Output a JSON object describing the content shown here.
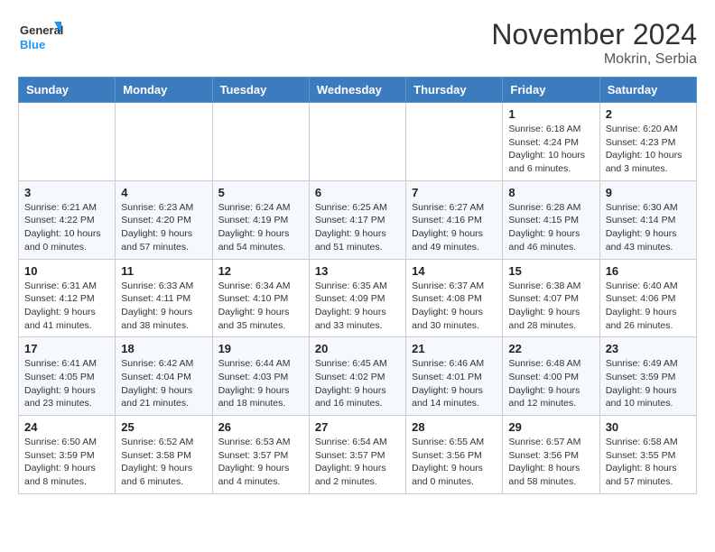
{
  "header": {
    "logo_line1": "General",
    "logo_line2": "Blue",
    "month": "November 2024",
    "location": "Mokrin, Serbia"
  },
  "weekdays": [
    "Sunday",
    "Monday",
    "Tuesday",
    "Wednesday",
    "Thursday",
    "Friday",
    "Saturday"
  ],
  "weeks": [
    [
      {
        "day": "",
        "info": ""
      },
      {
        "day": "",
        "info": ""
      },
      {
        "day": "",
        "info": ""
      },
      {
        "day": "",
        "info": ""
      },
      {
        "day": "",
        "info": ""
      },
      {
        "day": "1",
        "info": "Sunrise: 6:18 AM\nSunset: 4:24 PM\nDaylight: 10 hours\nand 6 minutes."
      },
      {
        "day": "2",
        "info": "Sunrise: 6:20 AM\nSunset: 4:23 PM\nDaylight: 10 hours\nand 3 minutes."
      }
    ],
    [
      {
        "day": "3",
        "info": "Sunrise: 6:21 AM\nSunset: 4:22 PM\nDaylight: 10 hours\nand 0 minutes."
      },
      {
        "day": "4",
        "info": "Sunrise: 6:23 AM\nSunset: 4:20 PM\nDaylight: 9 hours\nand 57 minutes."
      },
      {
        "day": "5",
        "info": "Sunrise: 6:24 AM\nSunset: 4:19 PM\nDaylight: 9 hours\nand 54 minutes."
      },
      {
        "day": "6",
        "info": "Sunrise: 6:25 AM\nSunset: 4:17 PM\nDaylight: 9 hours\nand 51 minutes."
      },
      {
        "day": "7",
        "info": "Sunrise: 6:27 AM\nSunset: 4:16 PM\nDaylight: 9 hours\nand 49 minutes."
      },
      {
        "day": "8",
        "info": "Sunrise: 6:28 AM\nSunset: 4:15 PM\nDaylight: 9 hours\nand 46 minutes."
      },
      {
        "day": "9",
        "info": "Sunrise: 6:30 AM\nSunset: 4:14 PM\nDaylight: 9 hours\nand 43 minutes."
      }
    ],
    [
      {
        "day": "10",
        "info": "Sunrise: 6:31 AM\nSunset: 4:12 PM\nDaylight: 9 hours\nand 41 minutes."
      },
      {
        "day": "11",
        "info": "Sunrise: 6:33 AM\nSunset: 4:11 PM\nDaylight: 9 hours\nand 38 minutes."
      },
      {
        "day": "12",
        "info": "Sunrise: 6:34 AM\nSunset: 4:10 PM\nDaylight: 9 hours\nand 35 minutes."
      },
      {
        "day": "13",
        "info": "Sunrise: 6:35 AM\nSunset: 4:09 PM\nDaylight: 9 hours\nand 33 minutes."
      },
      {
        "day": "14",
        "info": "Sunrise: 6:37 AM\nSunset: 4:08 PM\nDaylight: 9 hours\nand 30 minutes."
      },
      {
        "day": "15",
        "info": "Sunrise: 6:38 AM\nSunset: 4:07 PM\nDaylight: 9 hours\nand 28 minutes."
      },
      {
        "day": "16",
        "info": "Sunrise: 6:40 AM\nSunset: 4:06 PM\nDaylight: 9 hours\nand 26 minutes."
      }
    ],
    [
      {
        "day": "17",
        "info": "Sunrise: 6:41 AM\nSunset: 4:05 PM\nDaylight: 9 hours\nand 23 minutes."
      },
      {
        "day": "18",
        "info": "Sunrise: 6:42 AM\nSunset: 4:04 PM\nDaylight: 9 hours\nand 21 minutes."
      },
      {
        "day": "19",
        "info": "Sunrise: 6:44 AM\nSunset: 4:03 PM\nDaylight: 9 hours\nand 18 minutes."
      },
      {
        "day": "20",
        "info": "Sunrise: 6:45 AM\nSunset: 4:02 PM\nDaylight: 9 hours\nand 16 minutes."
      },
      {
        "day": "21",
        "info": "Sunrise: 6:46 AM\nSunset: 4:01 PM\nDaylight: 9 hours\nand 14 minutes."
      },
      {
        "day": "22",
        "info": "Sunrise: 6:48 AM\nSunset: 4:00 PM\nDaylight: 9 hours\nand 12 minutes."
      },
      {
        "day": "23",
        "info": "Sunrise: 6:49 AM\nSunset: 3:59 PM\nDaylight: 9 hours\nand 10 minutes."
      }
    ],
    [
      {
        "day": "24",
        "info": "Sunrise: 6:50 AM\nSunset: 3:59 PM\nDaylight: 9 hours\nand 8 minutes."
      },
      {
        "day": "25",
        "info": "Sunrise: 6:52 AM\nSunset: 3:58 PM\nDaylight: 9 hours\nand 6 minutes."
      },
      {
        "day": "26",
        "info": "Sunrise: 6:53 AM\nSunset: 3:57 PM\nDaylight: 9 hours\nand 4 minutes."
      },
      {
        "day": "27",
        "info": "Sunrise: 6:54 AM\nSunset: 3:57 PM\nDaylight: 9 hours\nand 2 minutes."
      },
      {
        "day": "28",
        "info": "Sunrise: 6:55 AM\nSunset: 3:56 PM\nDaylight: 9 hours\nand 0 minutes."
      },
      {
        "day": "29",
        "info": "Sunrise: 6:57 AM\nSunset: 3:56 PM\nDaylight: 8 hours\nand 58 minutes."
      },
      {
        "day": "30",
        "info": "Sunrise: 6:58 AM\nSunset: 3:55 PM\nDaylight: 8 hours\nand 57 minutes."
      }
    ]
  ]
}
